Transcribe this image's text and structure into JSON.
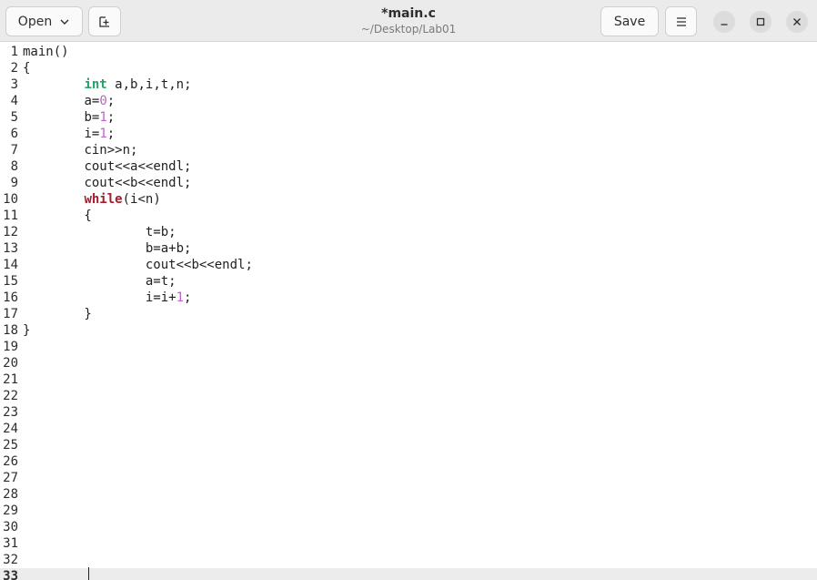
{
  "header": {
    "open_label": "Open",
    "title": "*main.c",
    "subtitle": "~/Desktop/Lab01",
    "save_label": "Save",
    "icons": [
      "chevron-down-icon",
      "new-tab-icon",
      "hamburger-menu-icon",
      "minimize-icon",
      "maximize-icon",
      "close-icon"
    ]
  },
  "editor": {
    "current_line": 33,
    "lines": [
      {
        "n": "1",
        "code": "main()"
      },
      {
        "n": "2",
        "code": "{"
      },
      {
        "n": "3",
        "code": "        int a,b,i,t,n;"
      },
      {
        "n": "4",
        "code": "        a=0;"
      },
      {
        "n": "5",
        "code": "        b=1;"
      },
      {
        "n": "6",
        "code": "        i=1;"
      },
      {
        "n": "7",
        "code": "        cin>>n;"
      },
      {
        "n": "8",
        "code": "        cout<<a<<endl;"
      },
      {
        "n": "9",
        "code": "        cout<<b<<endl;"
      },
      {
        "n": "10",
        "code": "        while(i<n)"
      },
      {
        "n": "11",
        "code": "        {"
      },
      {
        "n": "12",
        "code": "                t=b;"
      },
      {
        "n": "13",
        "code": "                b=a+b;"
      },
      {
        "n": "14",
        "code": "                cout<<b<<endl;"
      },
      {
        "n": "15",
        "code": "                a=t;"
      },
      {
        "n": "16",
        "code": "                i=i+1;"
      },
      {
        "n": "17",
        "code": "        }"
      },
      {
        "n": "18",
        "code": "}"
      },
      {
        "n": "19",
        "code": ""
      },
      {
        "n": "20",
        "code": ""
      },
      {
        "n": "21",
        "code": ""
      },
      {
        "n": "22",
        "code": ""
      },
      {
        "n": "23",
        "code": ""
      },
      {
        "n": "24",
        "code": ""
      },
      {
        "n": "25",
        "code": ""
      },
      {
        "n": "26",
        "code": ""
      },
      {
        "n": "27",
        "code": ""
      },
      {
        "n": "28",
        "code": ""
      },
      {
        "n": "29",
        "code": ""
      },
      {
        "n": "30",
        "code": ""
      },
      {
        "n": "31",
        "code": ""
      },
      {
        "n": "32",
        "code": ""
      },
      {
        "n": "33",
        "code": "        "
      }
    ],
    "colors": {
      "type": "#26a269",
      "keyword": "#a51d2d",
      "number": "#c061cb",
      "current_line_bg": "#ececec"
    }
  }
}
